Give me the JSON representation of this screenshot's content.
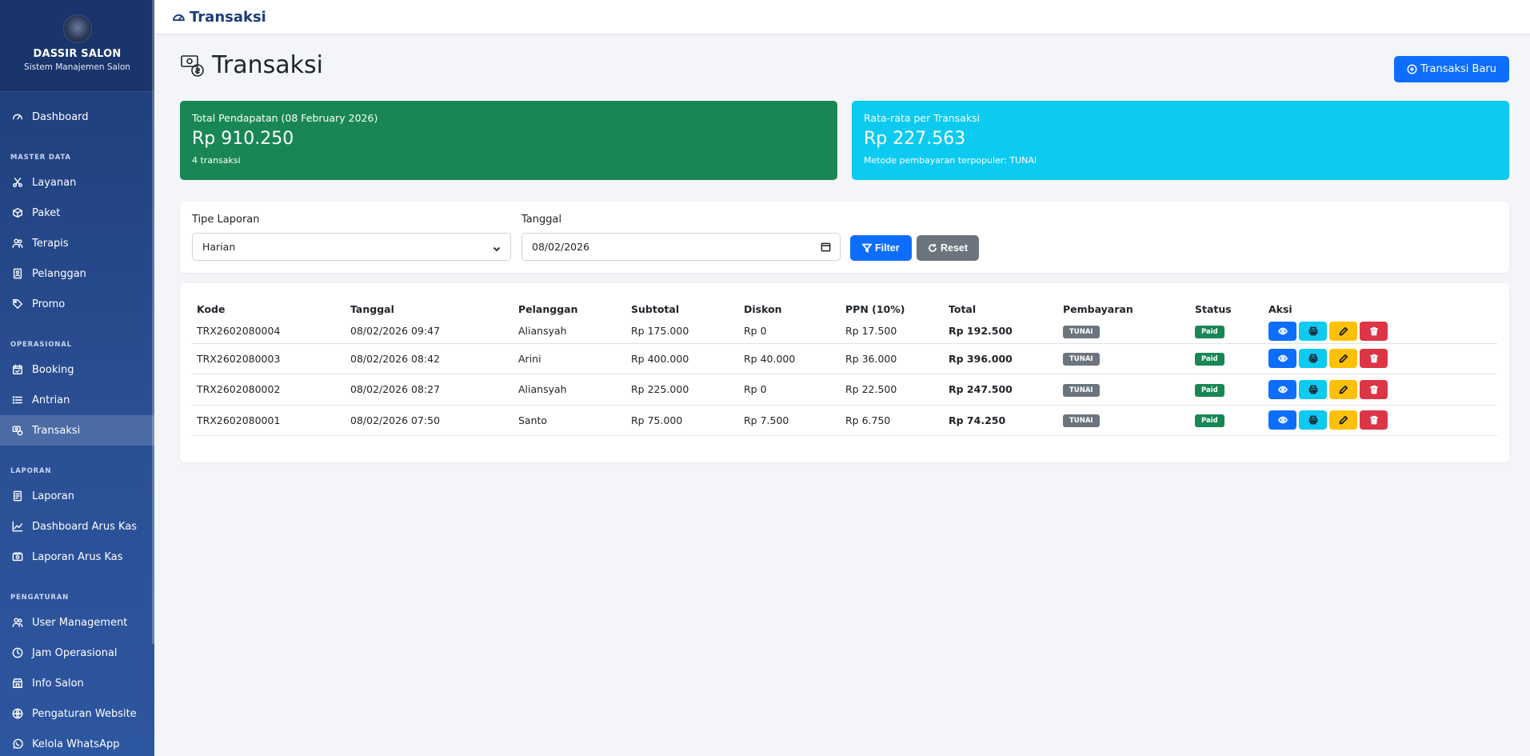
{
  "brand": {
    "name": "DASSIR SALON",
    "subtitle": "Sistem Manajemen Salon"
  },
  "sidebar": {
    "dashboard": "Dashboard",
    "sections": [
      {
        "title": "MASTER DATA",
        "items": [
          "Layanan",
          "Paket",
          "Terapis",
          "Pelanggan",
          "Promo"
        ]
      },
      {
        "title": "OPERASIONAL",
        "items": [
          "Booking",
          "Antrian",
          "Transaksi"
        ]
      },
      {
        "title": "LAPORAN",
        "items": [
          "Laporan",
          "Dashboard Arus Kas",
          "Laporan Arus Kas"
        ]
      },
      {
        "title": "PENGATURAN",
        "items": [
          "User Management",
          "Jam Operasional",
          "Info Salon",
          "Pengaturan Website",
          "Kelola WhatsApp"
        ]
      }
    ],
    "active_item": "Transaksi"
  },
  "topbar": {
    "title": "Transaksi"
  },
  "page": {
    "title": "Transaksi",
    "new_button": "Transaksi Baru"
  },
  "stats": {
    "total": {
      "label": "Total Pendapatan (08 February 2026)",
      "value": "Rp 910.250",
      "sub": "4 transaksi"
    },
    "average": {
      "label": "Rata-rata per Transaksi",
      "value": "Rp 227.563",
      "sub": "Metode pembayaran terpopuler: TUNAI"
    }
  },
  "filter": {
    "type_label": "Tipe Laporan",
    "type_value": "Harian",
    "date_label": "Tanggal",
    "date_value": "08/02/2026",
    "filter_button": "Filter",
    "reset_button": "Reset"
  },
  "table": {
    "headers": [
      "Kode",
      "Tanggal",
      "Pelanggan",
      "Subtotal",
      "Diskon",
      "PPN (10%)",
      "Total",
      "Pembayaran",
      "Status",
      "Aksi"
    ],
    "rows": [
      [
        "TRX2602080004",
        "08/02/2026 09:47",
        "Aliansyah",
        "Rp 175.000",
        "Rp 0",
        "Rp 17.500",
        "Rp 192.500",
        "TUNAI",
        "Paid"
      ],
      [
        "TRX2602080003",
        "08/02/2026 08:42",
        "Arini",
        "Rp 400.000",
        "Rp 40.000",
        "Rp 36.000",
        "Rp 396.000",
        "TUNAI",
        "Paid"
      ],
      [
        "TRX2602080002",
        "08/02/2026 08:27",
        "Aliansyah",
        "Rp 225.000",
        "Rp 0",
        "Rp 22.500",
        "Rp 247.500",
        "TUNAI",
        "Paid"
      ],
      [
        "TRX2602080001",
        "08/02/2026 07:50",
        "Santo",
        "Rp 75.000",
        "Rp 7.500",
        "Rp 6.750",
        "Rp 74.250",
        "TUNAI",
        "Paid"
      ]
    ]
  }
}
